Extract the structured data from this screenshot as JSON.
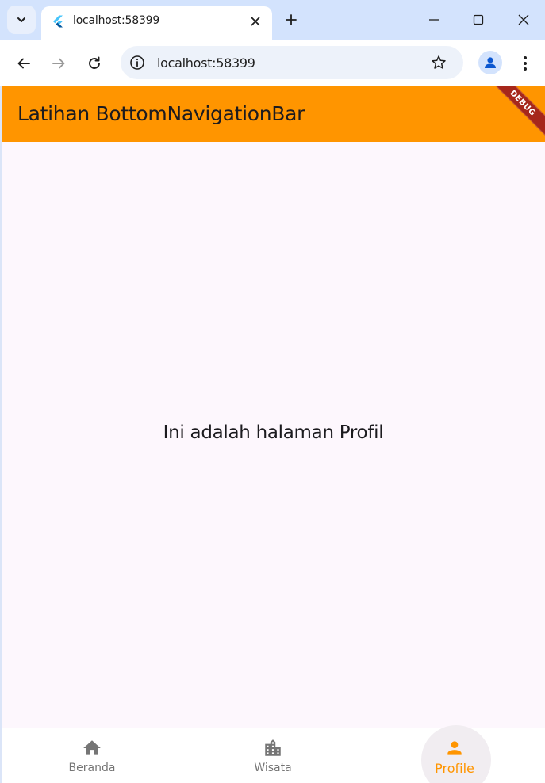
{
  "browser": {
    "tab": {
      "title": "localhost:58399",
      "favicon": "flutter-icon"
    },
    "address_bar": {
      "url": "localhost:58399"
    },
    "icons": {
      "tab_search": "chevron-down-icon",
      "close_tab": "close-icon",
      "new_tab": "plus-icon",
      "minimize": "minimize-icon",
      "maximize": "maximize-icon",
      "close_window": "close-icon",
      "back": "arrow-left-icon",
      "forward": "arrow-right-icon",
      "reload": "reload-icon",
      "site_info": "info-icon",
      "bookmark": "star-icon",
      "profile": "person-icon",
      "menu": "kebab-menu-icon"
    }
  },
  "app": {
    "appbar": {
      "title": "Latihan BottomNavigationBar",
      "color": "#ff9500"
    },
    "debug_banner": "DEBUG",
    "body": {
      "text": "Ini adalah halaman Profil"
    },
    "bottom_nav": {
      "items": [
        {
          "label": "Beranda",
          "icon": "home-icon",
          "active": false
        },
        {
          "label": "Wisata",
          "icon": "city-icon",
          "active": false
        },
        {
          "label": "Profile",
          "icon": "person-icon",
          "active": true
        }
      ],
      "active_color": "#ff9500",
      "inactive_color": "#757575"
    }
  }
}
